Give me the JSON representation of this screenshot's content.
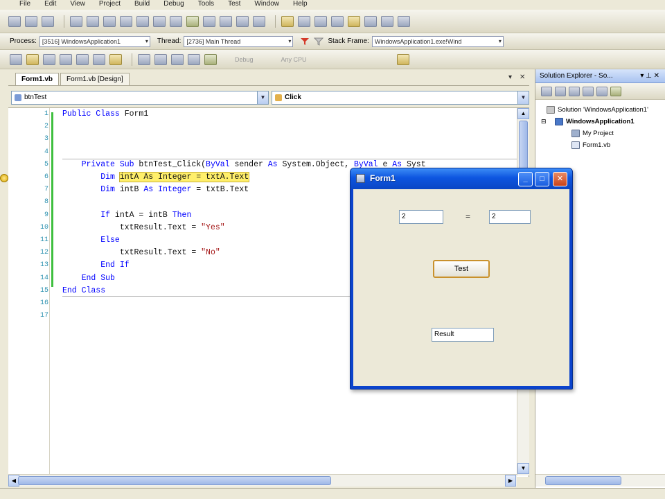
{
  "menu": [
    "File",
    "Edit",
    "View",
    "Project",
    "Build",
    "Debug",
    "Tools",
    "Test",
    "Window",
    "Help"
  ],
  "debug_toolbar": {
    "process_label": "Process:",
    "process_value": "[3516] WindowsApplication1",
    "thread_label": "Thread:",
    "thread_value": "[2736] Main Thread",
    "stackframe_label": "Stack Frame:",
    "stackframe_value": "WindowsApplication1.exe!Wind"
  },
  "toolbar3": {
    "ghost_1": "Debug",
    "ghost_2": "Any CPU"
  },
  "doc_tabs": [
    {
      "label": "Form1.vb",
      "active": true
    },
    {
      "label": "Form1.vb [Design]",
      "active": false
    }
  ],
  "member_nav": {
    "object": "btnTest",
    "member": "Click"
  },
  "code_lines": [
    {
      "n": "1",
      "segs": [
        [
          "kw",
          "Public Class "
        ],
        [
          "",
          "Form1"
        ]
      ]
    },
    {
      "n": "2",
      "segs": []
    },
    {
      "n": "3",
      "segs": []
    },
    {
      "n": "4",
      "segs": []
    },
    {
      "n": "5",
      "segs": [
        [
          "kw",
          "    Private Sub "
        ],
        [
          "",
          "btnTest_Click("
        ],
        [
          "kw",
          "ByVal "
        ],
        [
          "",
          "sender "
        ],
        [
          "kw",
          "As "
        ],
        [
          "",
          "System.Object, "
        ],
        [
          "kw",
          "ByVal "
        ],
        [
          "",
          "e "
        ],
        [
          "kw",
          "As "
        ],
        [
          "",
          "Syst"
        ]
      ]
    },
    {
      "n": "6",
      "segs": [
        [
          "kw",
          "        Dim "
        ],
        [
          "hl",
          "intA As Integer = txtA.Text"
        ]
      ]
    },
    {
      "n": "7",
      "segs": [
        [
          "kw",
          "        Dim "
        ],
        [
          "",
          "intB "
        ],
        [
          "kw",
          "As Integer "
        ],
        [
          "",
          "= txtB.Text"
        ]
      ]
    },
    {
      "n": "8",
      "segs": []
    },
    {
      "n": "9",
      "segs": [
        [
          "kw",
          "        If "
        ],
        [
          "",
          "intA = intB "
        ],
        [
          "kw",
          "Then"
        ]
      ]
    },
    {
      "n": "10",
      "segs": [
        [
          "",
          "            txtResult.Text = "
        ],
        [
          "str",
          "\"Yes\""
        ]
      ]
    },
    {
      "n": "11",
      "segs": [
        [
          "kw",
          "        Else"
        ]
      ]
    },
    {
      "n": "12",
      "segs": [
        [
          "",
          "            txtResult.Text = "
        ],
        [
          "str",
          "\"No\""
        ]
      ]
    },
    {
      "n": "13",
      "segs": [
        [
          "kw",
          "        End If"
        ]
      ]
    },
    {
      "n": "14",
      "segs": [
        [
          "kw",
          "    End Sub"
        ]
      ]
    },
    {
      "n": "15",
      "segs": [
        [
          "kw",
          "End Class"
        ]
      ]
    },
    {
      "n": "16",
      "segs": []
    },
    {
      "n": "17",
      "segs": []
    }
  ],
  "solution_explorer": {
    "title": "Solution Explorer - So...",
    "items": [
      {
        "label": "Solution 'WindowsApplication1'",
        "level": 0
      },
      {
        "label": "WindowsApplication1",
        "level": 1
      },
      {
        "label": "My Project",
        "level": 2
      },
      {
        "label": "Form1.vb",
        "level": 2
      }
    ]
  },
  "form_window": {
    "title": "Form1",
    "txtA_value": "2",
    "equals": "=",
    "txtB_value": "2",
    "test_button": "Test",
    "result_value": "Result"
  },
  "colors": {
    "keyword": "#0000ff",
    "string": "#a31515",
    "highlight": "#ffef6b",
    "xp_blue": "#0b43cc"
  }
}
